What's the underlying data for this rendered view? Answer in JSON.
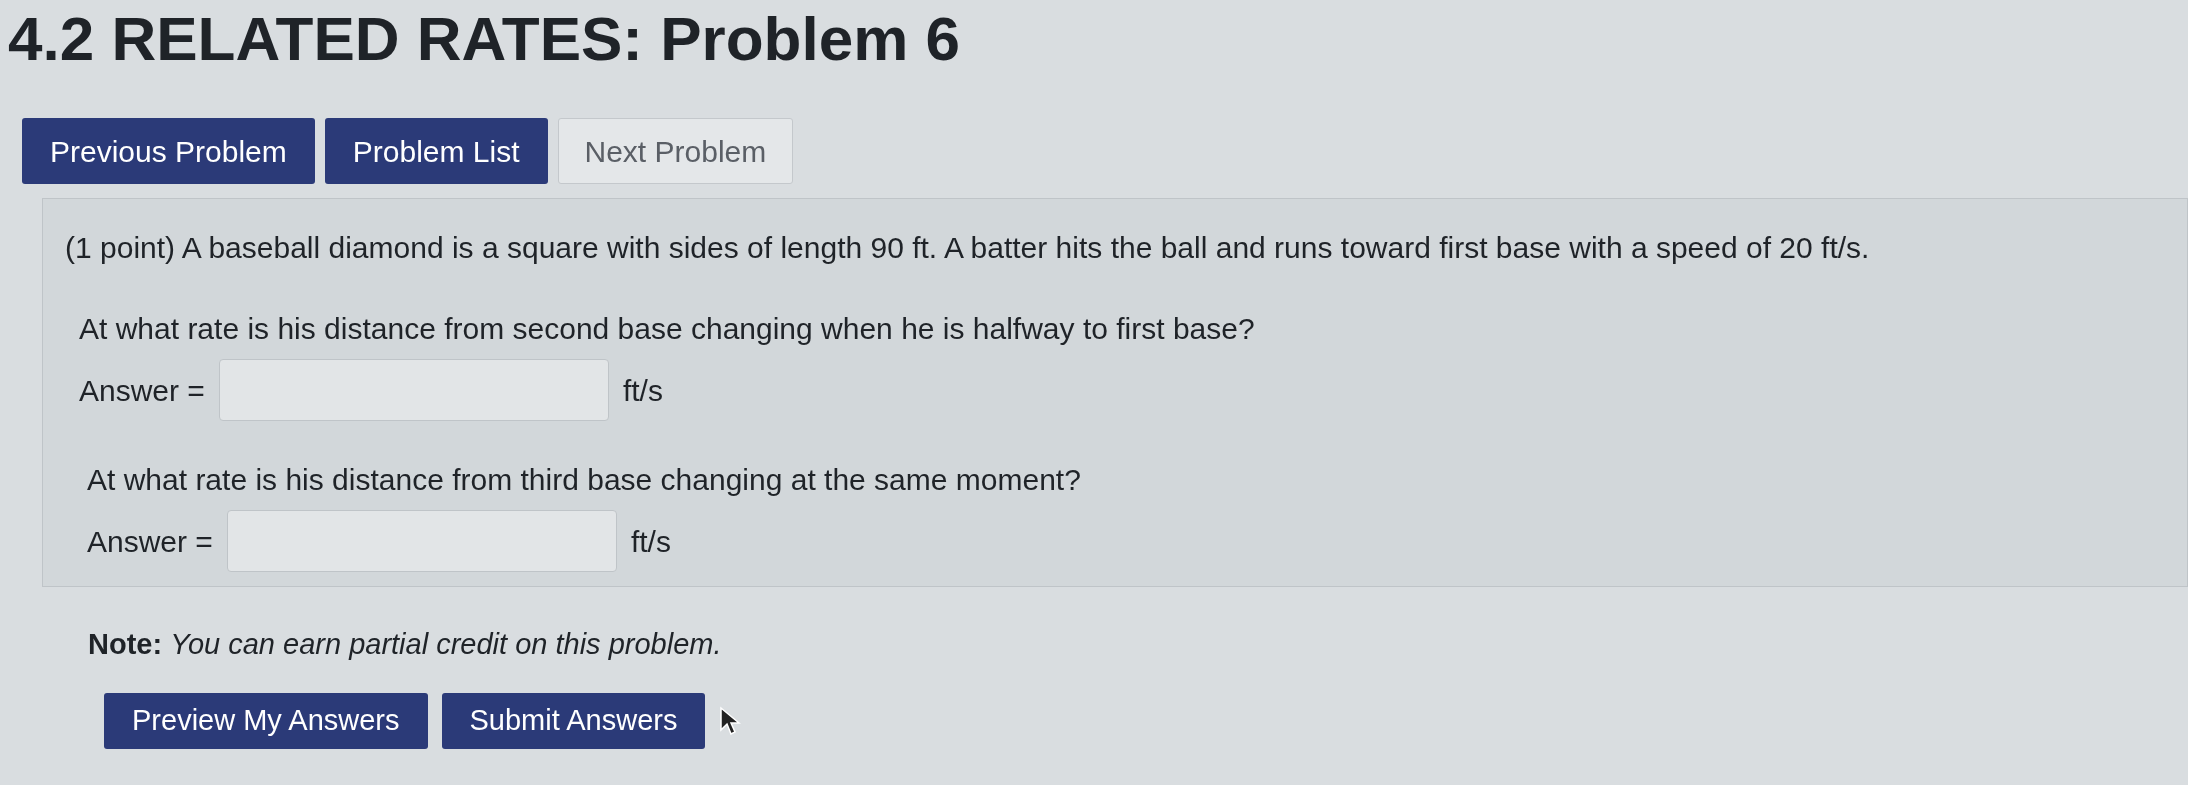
{
  "title": "4.2 RELATED RATES: Problem 6",
  "nav_buttons": [
    {
      "label": "Previous Problem",
      "disabled": false
    },
    {
      "label": "Problem List",
      "disabled": false
    },
    {
      "label": "Next Problem",
      "disabled": true
    }
  ],
  "problem": {
    "statement": "(1 point) A baseball diamond is a square with sides of length 90 ft. A batter hits the ball and runs toward first base with a speed of 20 ft/s.",
    "parts": [
      {
        "question": "At what rate is his distance from second base changing when he is halfway to first base?",
        "answer_label": "Answer =",
        "unit": "ft/s"
      },
      {
        "question": "At what rate is his distance from third base changing at the same moment?",
        "answer_label": "Answer =",
        "unit": "ft/s"
      }
    ]
  },
  "note": "**Note:** *You can earn partial credit on this problem.*",
  "action_buttons": [
    "Preview My Answers",
    "Submit Answers"
  ]
}
